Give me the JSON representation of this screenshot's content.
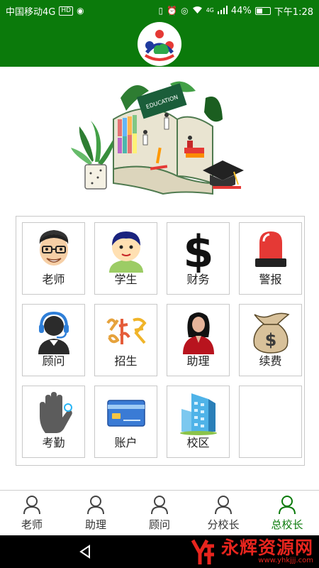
{
  "status_bar": {
    "carrier": "中国移动4G",
    "hd_badge": "HD",
    "network_badge": "4G",
    "battery": "44%",
    "battery_level": 0.44,
    "time": "下午1:28"
  },
  "grid": {
    "tiles": [
      {
        "label": "老师",
        "icon": "teacher-avatar-icon"
      },
      {
        "label": "学生",
        "icon": "student-avatar-icon"
      },
      {
        "label": "财务",
        "icon": "dollar-icon"
      },
      {
        "label": "警报",
        "icon": "alarm-light-icon"
      },
      {
        "label": "顾问",
        "icon": "headset-consultant-icon"
      },
      {
        "label": "招生",
        "icon": "enrollment-calligraphy-icon"
      },
      {
        "label": "助理",
        "icon": "assistant-woman-icon"
      },
      {
        "label": "续费",
        "icon": "money-bag-icon"
      },
      {
        "label": "考勤",
        "icon": "fingerprint-hand-icon"
      },
      {
        "label": "账户",
        "icon": "bank-card-icon"
      },
      {
        "label": "校区",
        "icon": "campus-building-icon"
      }
    ]
  },
  "tabs": [
    {
      "label": "老师",
      "active": false
    },
    {
      "label": "助理",
      "active": false
    },
    {
      "label": "顾问",
      "active": false
    },
    {
      "label": "分校长",
      "active": false
    },
    {
      "label": "总校长",
      "active": true
    }
  ],
  "hero": {
    "book_text": "EDUCATION"
  },
  "watermark": {
    "main": "永辉资源网",
    "sub": "www.yhkjjj.com"
  },
  "colors": {
    "primary_green": "#0b7a0b",
    "active_tab": "#0b7a0b",
    "watermark_red": "#e8251e"
  }
}
